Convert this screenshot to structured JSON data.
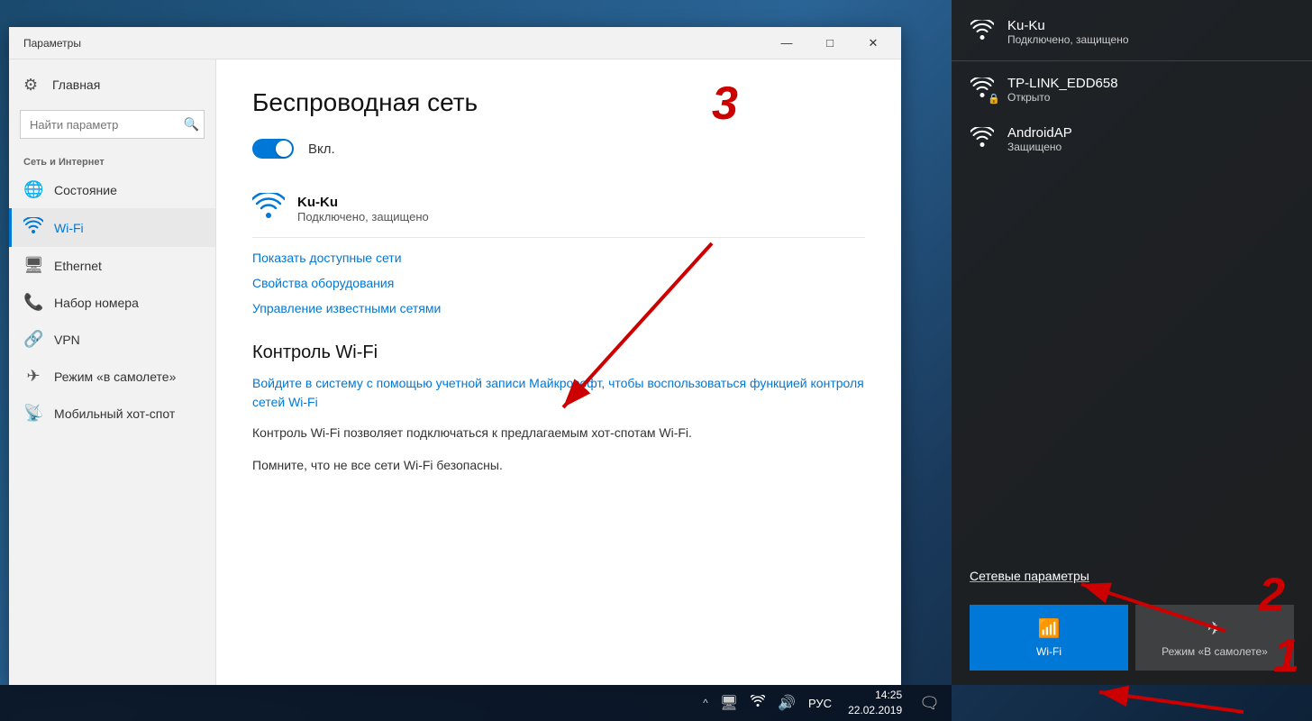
{
  "window": {
    "title": "Параметры",
    "controls": {
      "minimize": "—",
      "maximize": "□",
      "close": "✕"
    }
  },
  "sidebar": {
    "home_label": "Главная",
    "search_placeholder": "Найти параметр",
    "section_label": "Сеть и Интернет",
    "items": [
      {
        "id": "status",
        "label": "Состояние",
        "icon": "🌐"
      },
      {
        "id": "wifi",
        "label": "Wi-Fi",
        "icon": "📶",
        "active": true
      },
      {
        "id": "ethernet",
        "label": "Ethernet",
        "icon": "🖥"
      },
      {
        "id": "dialup",
        "label": "Набор номера",
        "icon": "📞"
      },
      {
        "id": "vpn",
        "label": "VPN",
        "icon": "🔗"
      },
      {
        "id": "airplane",
        "label": "Режим «в самолете»",
        "icon": "✈"
      },
      {
        "id": "hotspot",
        "label": "Мобильный хот-спот",
        "icon": "📡"
      }
    ]
  },
  "main": {
    "page_title": "Беспроводная сеть",
    "toggle_label": "Вкл.",
    "current_network": {
      "name": "Ku-Ku",
      "status": "Подключено, защищено"
    },
    "links": {
      "show_networks": "Показать доступные сети",
      "adapter_properties": "Свойства оборудования",
      "manage_networks": "Управление известными сетями"
    },
    "wifi_sense": {
      "title": "Контроль Wi-Fi",
      "signin_link": "Войдите в систему с помощью учетной записи Майкрософт, чтобы воспользоваться функцией контроля сетей Wi-Fi",
      "description": "Контроль Wi-Fi позволяет подключаться к предлагаемым хот-спотам Wi-Fi.",
      "warning": "Помните, что не все сети Wi-Fi безопасны."
    }
  },
  "wifi_panel": {
    "networks": [
      {
        "name": "Ku-Ku",
        "status": "Подключено, защищено",
        "connected": true,
        "secured": true
      },
      {
        "name": "TP-LINK_EDD658",
        "status": "Открыто",
        "connected": false,
        "secured": false,
        "lock": true
      },
      {
        "name": "AndroidAP",
        "status": "Защищено",
        "connected": false,
        "secured": true
      }
    ],
    "network_settings": "Сетевые параметры",
    "quick_actions": [
      {
        "label": "Wi-Fi",
        "active": true
      },
      {
        "label": "Режим «В самолете»",
        "active": false
      }
    ]
  },
  "taskbar": {
    "tray_icons": [
      "^",
      "🖥",
      "📶",
      "🔊"
    ],
    "language": "РУС",
    "time": "14:25",
    "date": "22.02.2019"
  },
  "annotations": {
    "num1": "1",
    "num2": "2",
    "num3": "3"
  }
}
